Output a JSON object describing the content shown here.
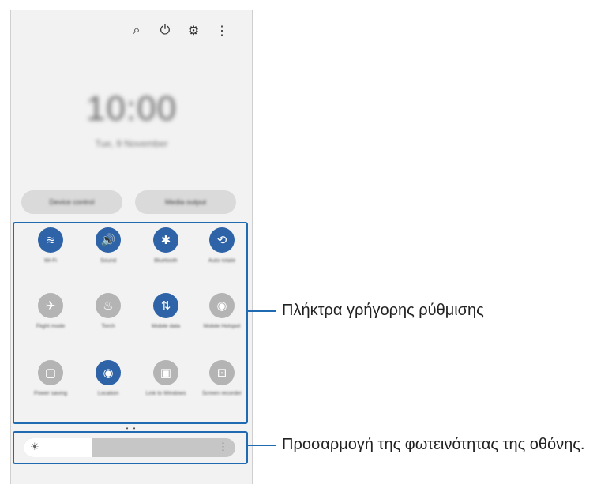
{
  "topbar": {
    "icons": [
      "search-icon",
      "power-icon",
      "gear-icon",
      "more-vertical-icon"
    ],
    "glyphs": [
      "⌕",
      "⏻",
      "⚙",
      "⋮"
    ]
  },
  "lock": {
    "time": "10:00",
    "date": "Tue, 9 November"
  },
  "buttons": {
    "device_control": "Device control",
    "media_output": "Media output"
  },
  "quick_settings": [
    {
      "label": "Wi-Fi",
      "icon": "wifi-icon",
      "glyph": "≋",
      "on": true
    },
    {
      "label": "Sound",
      "icon": "sound-icon",
      "glyph": "🔊",
      "on": true
    },
    {
      "label": "Bluetooth",
      "icon": "bluetooth-icon",
      "glyph": "✱",
      "on": true
    },
    {
      "label": "Auto rotate",
      "icon": "auto-rotate-icon",
      "glyph": "⟲",
      "on": true
    },
    {
      "label": "Flight mode",
      "icon": "airplane-icon",
      "glyph": "✈",
      "on": false
    },
    {
      "label": "Torch",
      "icon": "torch-icon",
      "glyph": "♨",
      "on": false
    },
    {
      "label": "Mobile data",
      "icon": "mobile-data-icon",
      "glyph": "⇅",
      "on": true
    },
    {
      "label": "Mobile Hotspot",
      "icon": "hotspot-icon",
      "glyph": "◉",
      "on": false
    },
    {
      "label": "Power saving",
      "icon": "power-saving-icon",
      "glyph": "▢",
      "on": false
    },
    {
      "label": "Location",
      "icon": "location-icon",
      "glyph": "◉",
      "on": true
    },
    {
      "label": "Link to Windows",
      "icon": "link-to-windows-icon",
      "glyph": "▣",
      "on": false
    },
    {
      "label": "Screen recorder",
      "icon": "screen-recorder-icon",
      "glyph": "⊡",
      "on": false
    }
  ],
  "page_dots": "• •",
  "brightness": {
    "level": 0.32,
    "sun_glyph": "☀",
    "more_glyph": "⋮"
  },
  "callouts": {
    "quick_settings": "Πλήκτρα γρήγορης ρύθμισης",
    "brightness": "Προσαρμογή της φωτεινότητας της οθόνης."
  },
  "colors": {
    "accent": "#1f6ab0",
    "tile_on": "#2e63a8",
    "tile_off": "#b4b4b4"
  }
}
